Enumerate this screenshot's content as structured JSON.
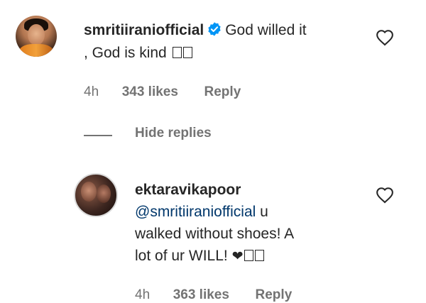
{
  "comments": [
    {
      "username": "smritiiraniofficial",
      "verified": true,
      "text_line1": "God willed it",
      "text_line2": ", God is kind",
      "emoji_trail": "□□",
      "time": "4h",
      "likes": "343 likes",
      "reply_label": "Reply"
    }
  ],
  "hide_replies_label": "Hide replies",
  "replies": [
    {
      "username": "ektaravikapoor",
      "mention": "@smritiiraniofficial",
      "text_after_mention": " u",
      "text_line2": "walked without shoes! A",
      "text_line3": "lot of ur WILL!",
      "emoji_trail": "❤□□",
      "time": "4h",
      "likes": "363 likes",
      "reply_label": "Reply"
    }
  ],
  "colors": {
    "text": "#262626",
    "muted": "#737373",
    "mention": "#00376b",
    "verified": "#0095f6"
  },
  "icons": {
    "verified": "verified-badge-icon",
    "like": "heart-outline-icon"
  }
}
